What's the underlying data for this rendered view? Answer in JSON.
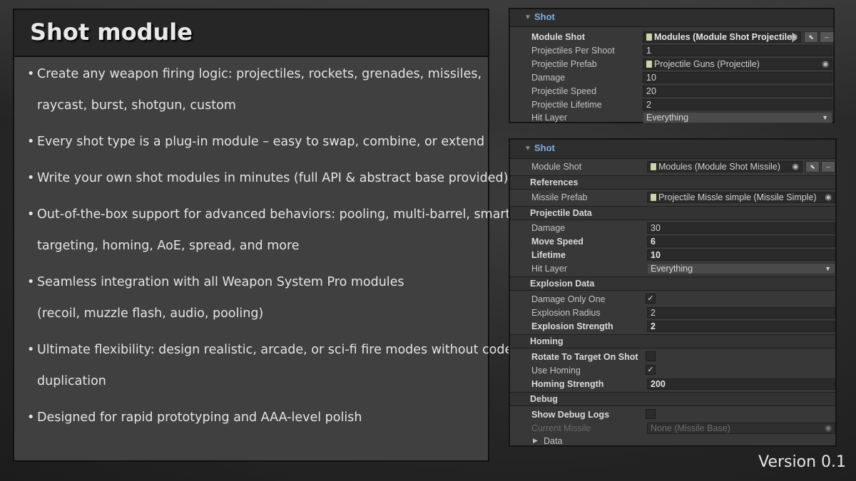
{
  "left": {
    "title": "Shot module",
    "features": [
      [
        "Create any weapon firing logic: projectiles, rockets, grenades, missiles,",
        "raycast, burst, shotgun, custom"
      ],
      [
        "Every shot type is a plug-in module – easy to swap, combine, or extend"
      ],
      [
        "Write your own shot modules in minutes (full API & abstract base provided)"
      ],
      [
        "Out-of-the-box support for advanced behaviors: pooling, multi-barrel, smart",
        "targeting, homing, AoE, spread, and more"
      ],
      [
        "Seamless integration with all Weapon System Pro modules",
        "(recoil, muzzle flash, audio, pooling)"
      ],
      [
        "Ultimate flexibility: design realistic, arcade, or sci-fi fire modes without code",
        "duplication"
      ],
      [
        "Designed for rapid prototyping and AAA-level polish"
      ]
    ]
  },
  "inspector1": {
    "header": "Shot",
    "module_shot_label": "Module Shot",
    "module_shot_value": "Modules (Module Shot Projectile)",
    "rows": [
      {
        "label": "Projectiles Per Shoot",
        "value": "1"
      },
      {
        "label": "Projectile Prefab",
        "value": "Projectile Guns (Projectile)"
      },
      {
        "label": "Damage",
        "value": "10"
      },
      {
        "label": "Projectile Speed",
        "value": "20"
      },
      {
        "label": "Projectile Lifetime",
        "value": "2"
      },
      {
        "label": "Hit Layer",
        "value": "Everything"
      }
    ]
  },
  "inspector2": {
    "header": "Shot",
    "module_shot_label": "Module Shot",
    "module_shot_value": "Modules (Module Shot Missile)",
    "references": "References",
    "missile_prefab_label": "Missile Prefab",
    "missile_prefab_value": "Projectile Missle simple (Missile Simple)",
    "projectile_data": "Projectile Data",
    "damage_label": "Damage",
    "damage_value": "30",
    "move_speed_label": "Move Speed",
    "move_speed_value": "6",
    "lifetime_label": "Lifetime",
    "lifetime_value": "10",
    "hit_layer_label": "Hit Layer",
    "hit_layer_value": "Everything",
    "explosion_data": "Explosion Data",
    "damage_only_one_label": "Damage Only One",
    "damage_only_one_checked": true,
    "explosion_radius_label": "Explosion Radius",
    "explosion_radius_value": "2",
    "explosion_strength_label": "Explosion Strength",
    "explosion_strength_value": "2",
    "homing": "Homing",
    "rotate_label": "Rotate To Target On Shot",
    "rotate_checked": false,
    "use_homing_label": "Use Homing",
    "use_homing_checked": true,
    "homing_strength_label": "Homing Strength",
    "homing_strength_value": "200",
    "debug": "Debug",
    "show_debug_label": "Show Debug Logs",
    "show_debug_checked": false,
    "current_missile_label": "Current Missile",
    "current_missile_value": "None (Missile Base)",
    "data_foldout": "Data"
  },
  "version": "Version 0.1",
  "colors": {
    "accent_header": "#7fb0e8",
    "panel": "#404040",
    "inspector": "#383838"
  },
  "icons": {
    "object_picker": "target-icon",
    "foldout": "triangle-icon",
    "checkmark": "check-icon"
  }
}
